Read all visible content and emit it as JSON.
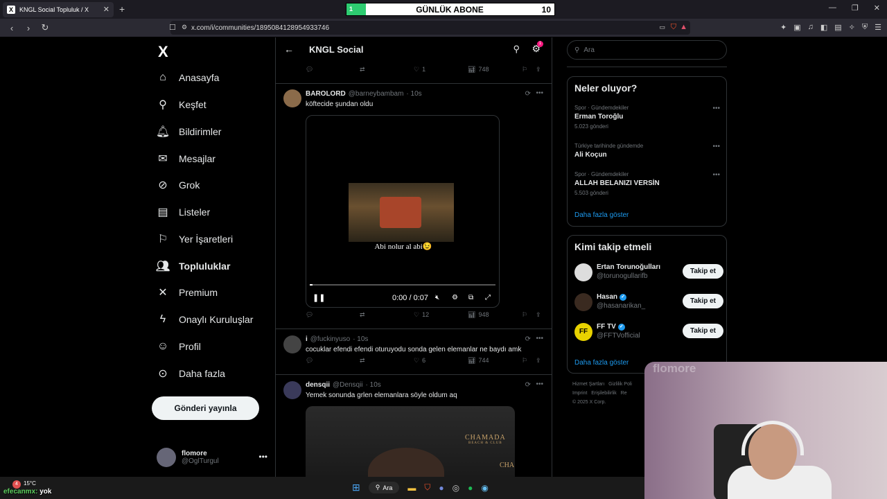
{
  "browser": {
    "tab_title": "KNGL Social Topluluk / X",
    "tab_favicon": "X",
    "url": "x.com/i/communities/1895084128954933746"
  },
  "overlay": {
    "progress_label": "1",
    "title": "GÜNLÜK ABONE",
    "count": "10",
    "progress_color": "#2ecc71"
  },
  "nav": {
    "logo": "X",
    "items": [
      {
        "label": "Anasayfa",
        "icon": "home-icon"
      },
      {
        "label": "Keşfet",
        "icon": "search-icon"
      },
      {
        "label": "Bildirimler",
        "icon": "bell-icon"
      },
      {
        "label": "Mesajlar",
        "icon": "mail-icon"
      },
      {
        "label": "Grok",
        "icon": "grok-icon"
      },
      {
        "label": "Listeler",
        "icon": "list-icon"
      },
      {
        "label": "Yer İşaretleri",
        "icon": "bookmark-icon"
      },
      {
        "label": "Topluluklar",
        "icon": "communities-icon"
      },
      {
        "label": "Premium",
        "icon": "x-icon"
      },
      {
        "label": "Onaylı Kuruluşlar",
        "icon": "lightning-icon"
      },
      {
        "label": "Profil",
        "icon": "profile-icon"
      },
      {
        "label": "Daha fazla",
        "icon": "more-circle-icon"
      }
    ],
    "post_button": "Gönderi yayınla",
    "profile": {
      "name": "flomore",
      "handle": "@OglTurgul"
    }
  },
  "feed": {
    "title": "KNGL Social",
    "settings_badge": "1",
    "top_actions": {
      "likes": "1",
      "views": "748"
    },
    "tweets": [
      {
        "name": "BAROLORD",
        "handle": "@barneybambam",
        "time": "· 10s",
        "text": "köftecide şundan oldu",
        "video": {
          "subtitle": "Abi nolur al abi😉",
          "time": "0:00 / 0:07",
          "progress": 0.01
        },
        "likes": "12",
        "views": "948"
      },
      {
        "name": "i",
        "handle": "@fuckinyuso",
        "time": "· 10s",
        "text": "cocuklar efendi efendi oturuyodu sonda gelen elemanlar ne baydı amk",
        "likes": "6",
        "views": "744"
      },
      {
        "name": "densqii",
        "handle": "@Densqii",
        "time": "· 10s",
        "text": "Yemek sonunda grlen elemanlara söyle oldum aq",
        "photo_brand": "CHAMADA",
        "photo_brand_sub": "BEACH & CLUB",
        "photo_brand_right": "CHA"
      }
    ]
  },
  "right": {
    "search_placeholder": "Ara",
    "trends_title": "Neler oluyor?",
    "trends": [
      {
        "context": "Spor · Gündemdekiler",
        "name": "Erman Toroğlu",
        "count": "5.023 gönderi"
      },
      {
        "context": "Türkiye tarihinde gündemde",
        "name": "Ali Koçun",
        "count": ""
      },
      {
        "context": "Spor · Gündemdekiler",
        "name": "ALLAH BELANIZI VERSİN",
        "count": "5.503 gönderi"
      }
    ],
    "trends_more": "Daha fazla göster",
    "who_title": "Kimi takip etmeli",
    "who": [
      {
        "name": "Ertan Torunoğulları",
        "handle": "@torunogullarifb",
        "verified": false,
        "button": "Takip et"
      },
      {
        "name": "Hasan",
        "handle": "@hasanarikan_",
        "verified": true,
        "button": "Takip et"
      },
      {
        "name": "FF TV",
        "handle": "@FFTVofficial",
        "verified": true,
        "button": "Takip et"
      }
    ],
    "who_more": "Daha fazla göster",
    "footer": [
      "Hizmet Şartları",
      "Gizlilik Poli",
      "Imprint",
      "Erişilebilirlik",
      "Re",
      "© 2025 X Corp."
    ]
  },
  "webcam": {
    "watermark": "flomore"
  },
  "taskbar": {
    "temperature": "15°C",
    "weather_badge": "4",
    "caption_user": "efecanmx:",
    "caption_text": " yok",
    "search": "Ara"
  }
}
